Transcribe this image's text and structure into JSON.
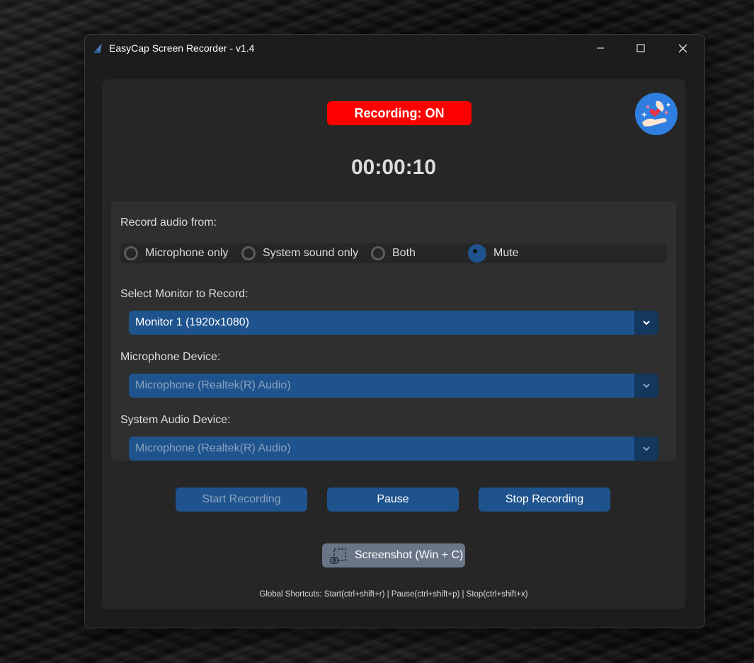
{
  "window": {
    "title": "EasyCap Screen Recorder - v1.4",
    "controls": {
      "minimize": "minimize-icon",
      "maximize": "maximize-icon",
      "close": "close-icon"
    }
  },
  "status": {
    "text": "Recording: ON",
    "color": "#ff0000"
  },
  "timer": "00:00:10",
  "audio": {
    "label": "Record audio from:",
    "options": [
      {
        "label": "Microphone only",
        "selected": false
      },
      {
        "label": "System sound only",
        "selected": false
      },
      {
        "label": "Both",
        "selected": false
      },
      {
        "label": "Mute",
        "selected": true
      }
    ]
  },
  "monitor": {
    "label": "Select Monitor to Record:",
    "value": "Monitor 1 (1920x1080)"
  },
  "microphone": {
    "label": "Microphone Device:",
    "value": "Microphone (Realtek(R) Audio)"
  },
  "system_audio": {
    "label": "System Audio Device:",
    "value": "Microphone (Realtek(R) Audio)"
  },
  "buttons": {
    "start": "Start Recording",
    "pause": "Pause",
    "stop": "Stop Recording",
    "screenshot": "Screenshot (Win + C)"
  },
  "footer": "Global Shortcuts: Start(ctrl+shift+r) | Pause(ctrl+shift+p) | Stop(ctrl+shift+x)",
  "colors": {
    "accent": "#1f538d",
    "accent_dark": "#14375e",
    "panel": "#262626",
    "recording": "#ff0000"
  }
}
